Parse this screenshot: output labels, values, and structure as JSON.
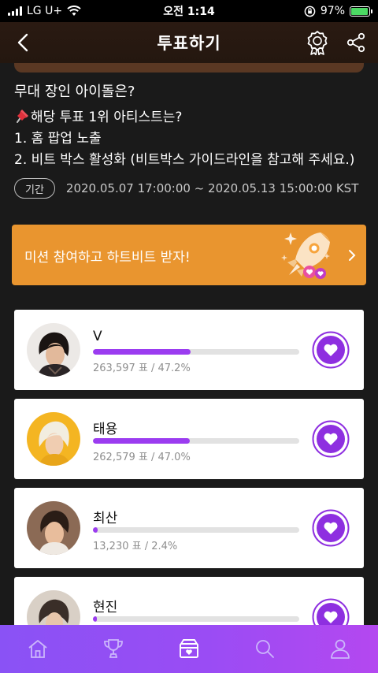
{
  "status_bar": {
    "carrier": "LG U+",
    "time": "오전 1:14",
    "battery": "97%",
    "battery_level": 0.97
  },
  "header": {
    "title": "투표하기",
    "back_icon": "chevron-left-icon",
    "award_icon": "award-ribbon-icon",
    "share_icon": "share-icon"
  },
  "poll": {
    "question": "무대 장인 아이돌은?",
    "benefit_heading": "해당 투표 1위 아티스트는?",
    "benefit_1": "1. 홈 팝업 노출",
    "benefit_2": "2. 비트 박스 활성화 (비트박스 가이드라인을 참고해 주세요.)",
    "period_label": "기간",
    "period": "2020.05.07 17:00:00 ~ 2020.05.13 15:00:00 KST"
  },
  "mission": {
    "text": "미션 참여하고 하트비트 받자!",
    "accent": "#e9952f"
  },
  "candidates": [
    {
      "name": "V",
      "votes": "263,597 표 / 47.2%",
      "share": 0.472
    },
    {
      "name": "태용",
      "votes": "262,579 표 / 47.0%",
      "share": 0.47
    },
    {
      "name": "최산",
      "votes": "13,230 표 / 2.4%",
      "share": 0.024
    },
    {
      "name": "현진",
      "votes": "",
      "share": 0.02
    }
  ],
  "colors": {
    "bar_fill": "#9b3cf0",
    "vote_button": "#8e2fe0",
    "tab_bar_start": "#8a52f5",
    "tab_bar_end": "#b448f0"
  },
  "tabs": [
    {
      "icon": "home-icon"
    },
    {
      "icon": "trophy-icon"
    },
    {
      "icon": "heart-box-icon",
      "active": true
    },
    {
      "icon": "search-icon"
    },
    {
      "icon": "profile-icon"
    }
  ]
}
